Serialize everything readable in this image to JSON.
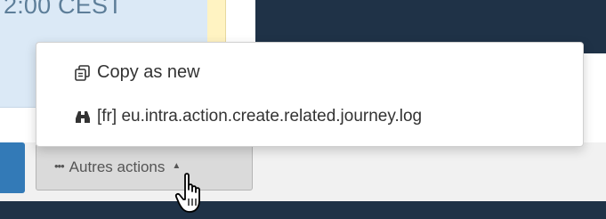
{
  "background": {
    "time_fragment": "2:00 CEST",
    "colors": {
      "card": "#dbe9f6",
      "dark_panel": "#1f3247",
      "primary": "#337ab7"
    }
  },
  "dropdown_menu": {
    "items": [
      {
        "icon": "copy-icon",
        "label": "Copy as new"
      },
      {
        "icon": "binoculars-icon",
        "label": "[fr] eu.intra.action.create.related.journey.log"
      }
    ]
  },
  "toolbar": {
    "more_actions": {
      "icon": "ellipsis-icon",
      "label": "Autres actions",
      "caret_icon": "caret-up-icon"
    }
  },
  "cursor": {
    "type": "hand-pointer-icon"
  }
}
